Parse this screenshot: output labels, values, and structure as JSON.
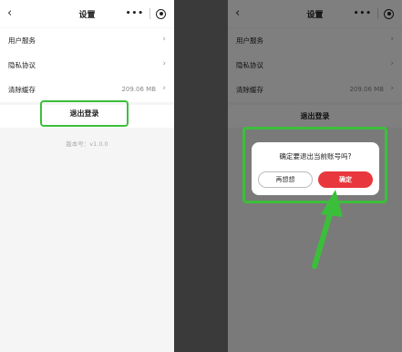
{
  "left_screen": {
    "nav": {
      "back_glyph": "‹",
      "title": "设置",
      "menu_glyph": "•••"
    },
    "rows": [
      {
        "label": "用户服务",
        "value": "",
        "chevron": "›"
      },
      {
        "label": "隐私协议",
        "value": "",
        "chevron": "›"
      },
      {
        "label": "清除缓存",
        "value": "209.06 MB",
        "chevron": "›"
      }
    ],
    "logout_label": "退出登录",
    "version": "版本号：v1.0.0"
  },
  "right_screen": {
    "nav": {
      "back_glyph": "‹",
      "title": "设置",
      "menu_glyph": "•••"
    },
    "rows": [
      {
        "label": "用户服务",
        "value": "",
        "chevron": "›"
      },
      {
        "label": "隐私协议",
        "value": "",
        "chevron": "›"
      },
      {
        "label": "清除缓存",
        "value": "209.06 MB",
        "chevron": "›"
      }
    ],
    "logout_label": "退出登录",
    "dialog": {
      "message": "确定要退出当前账号吗?",
      "cancel_label": "再想想",
      "confirm_label": "确定"
    }
  },
  "colors": {
    "highlight_green": "#3bbf3b",
    "confirm_red": "#e8383d",
    "dark_gap": "#3a3a3a"
  },
  "icons": [
    "back-chevron-icon",
    "more-dots-icon",
    "close-target-icon",
    "chevron-right-icon",
    "arrow-pointer-icon"
  ]
}
